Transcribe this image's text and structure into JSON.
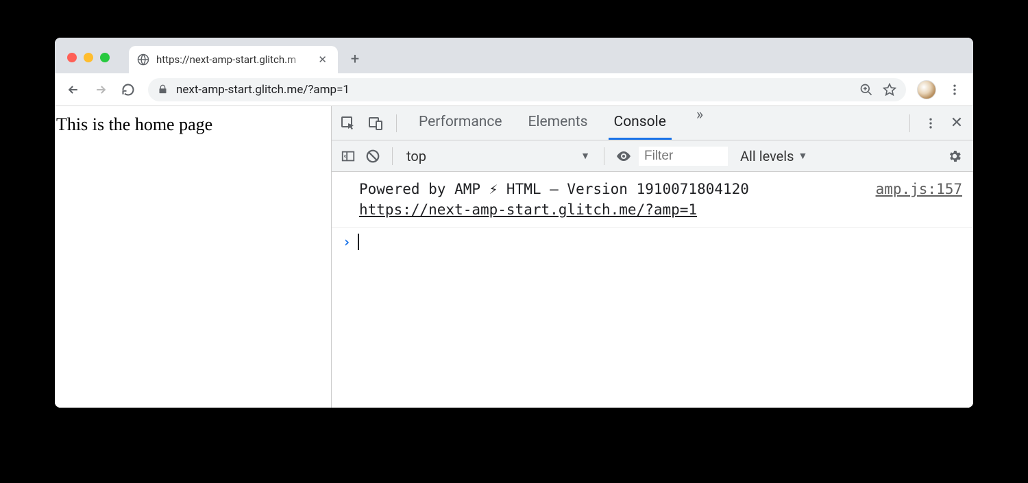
{
  "browser": {
    "tab_title": "https://next-amp-start.glitch.m",
    "url": "next-amp-start.glitch.me/?amp=1"
  },
  "page": {
    "body_text": "This is the home page"
  },
  "devtools": {
    "tabs": {
      "performance": "Performance",
      "elements": "Elements",
      "console": "Console"
    },
    "filterbar": {
      "context": "top",
      "filter_placeholder": "Filter",
      "levels": "All levels"
    },
    "console": {
      "log_text_1": "Powered by AMP ⚡ HTML – Version 1910071804120",
      "log_text_2": "https://next-amp-start.glitch.me/?amp=1",
      "log_source": "amp.js:157"
    }
  }
}
